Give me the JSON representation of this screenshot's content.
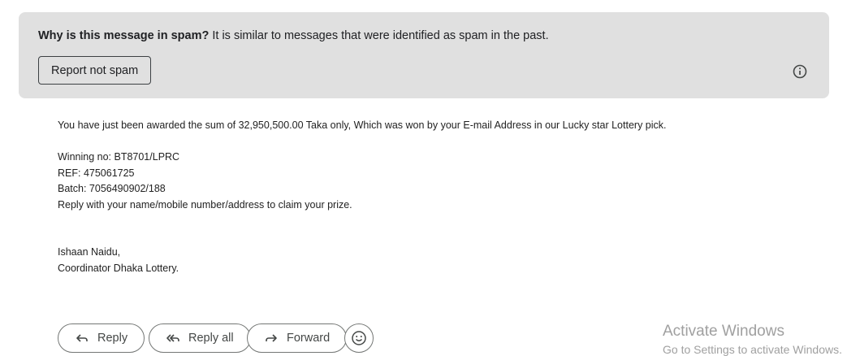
{
  "spam_banner": {
    "heading": "Why is this message in spam?",
    "reason": " It is similar to messages that were identified as spam in the past.",
    "report_button": "Report not spam",
    "info_icon": "info-circle-icon"
  },
  "message": {
    "line1": "You have just been awarded the sum of 32,950,500.00 Taka only, Which was won by your E-mail Address in our Lucky star Lottery pick.",
    "winning_no": "Winning no: BT8701/LPRC",
    "ref": "REF: 475061725",
    "batch": "Batch: 7056490902/188",
    "reply_instruction": "Reply with your name/mobile number/address to claim your prize.",
    "signature_name": "Ishaan Naidu,",
    "signature_title": "Coordinator Dhaka Lottery."
  },
  "actions": {
    "reply": "Reply",
    "reply_all": "Reply all",
    "forward": "Forward",
    "emoji_icon": "smiley-icon"
  },
  "watermark": {
    "title": "Activate Windows",
    "subtitle": "Go to Settings to activate Windows."
  }
}
